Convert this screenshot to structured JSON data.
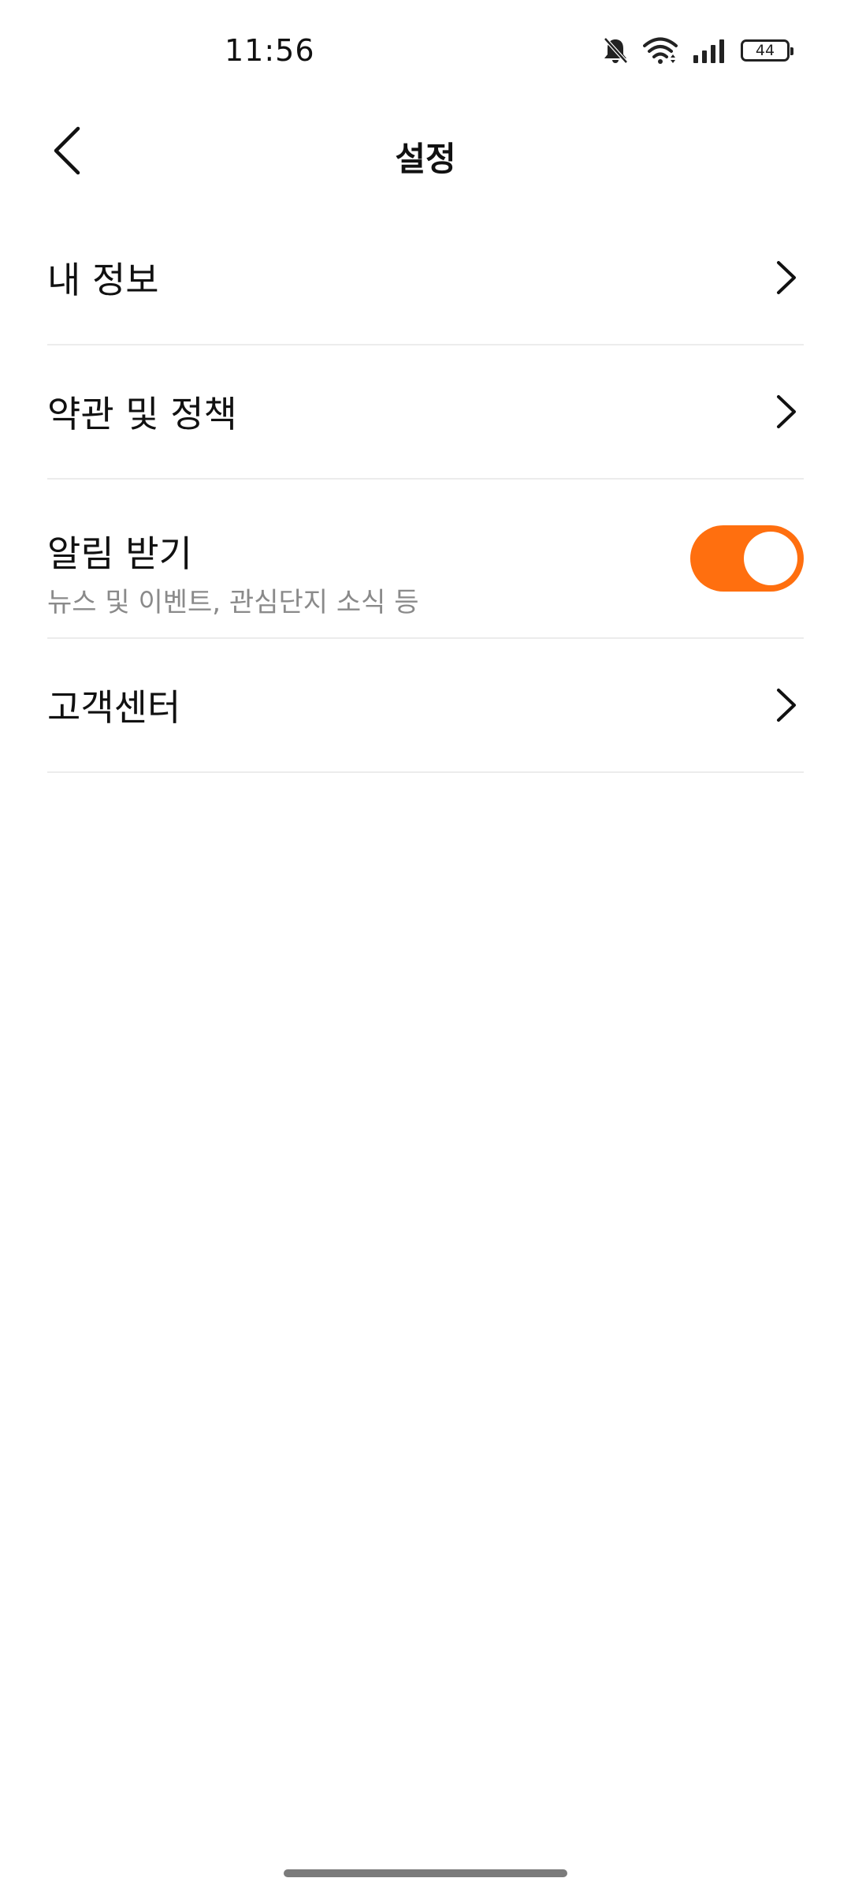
{
  "status_bar": {
    "time": "11:56",
    "battery": "44",
    "icons": [
      "bell-muted-icon",
      "wifi-icon",
      "signal-icon",
      "battery-icon"
    ]
  },
  "header": {
    "title": "설정",
    "back_icon": "chevron-left-icon"
  },
  "settings": {
    "my_info": {
      "label": "내 정보"
    },
    "terms": {
      "label": "약관 및 정책"
    },
    "notifications": {
      "label": "알림 받기",
      "description": "뉴스 및 이벤트, 관심단지 소식 등",
      "enabled": true
    },
    "customer_center": {
      "label": "고객센터"
    }
  },
  "colors": {
    "accent": "#ff6f0f",
    "divider": "#ececec",
    "secondary_text": "#8a8a8a"
  }
}
